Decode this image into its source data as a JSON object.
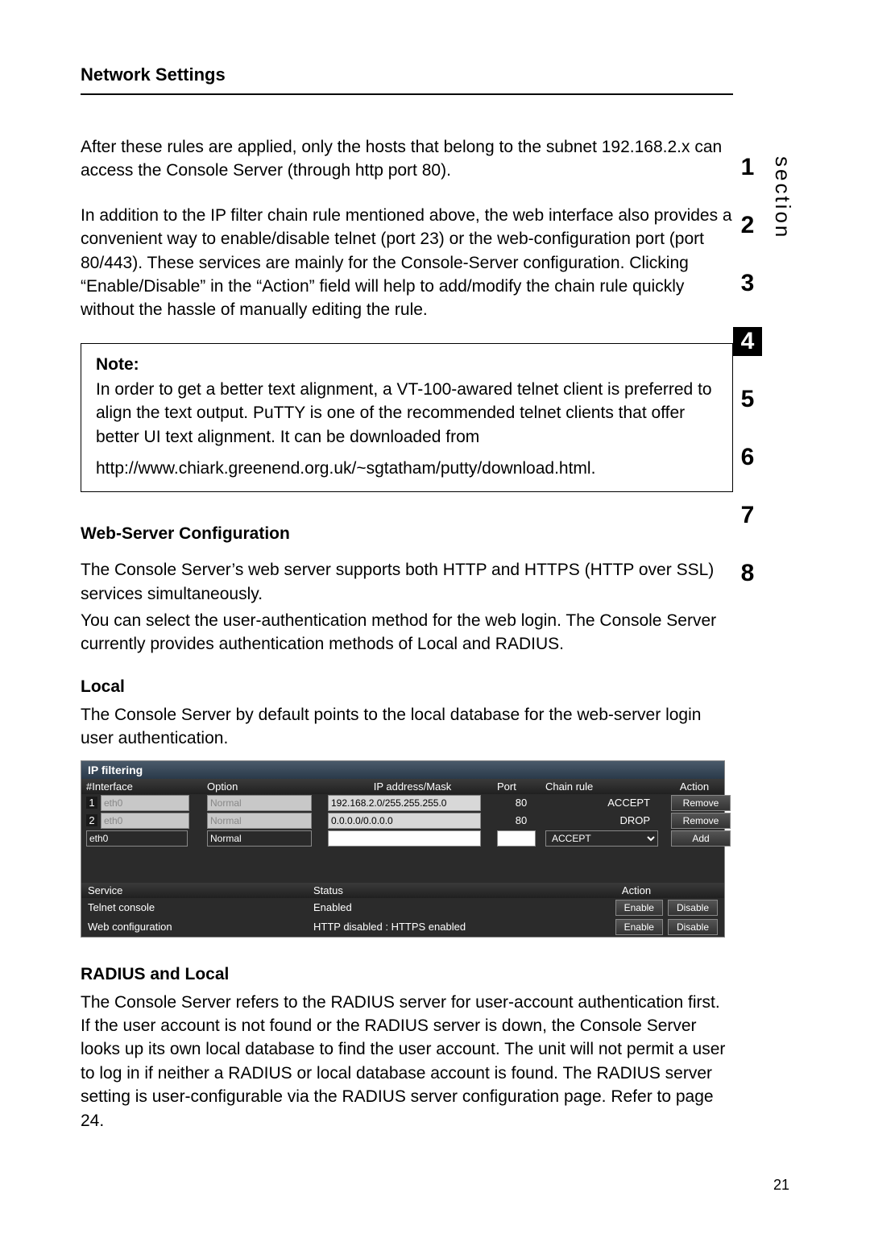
{
  "page_title": "Network Settings",
  "page_number": "21",
  "sidebar": {
    "label": "section",
    "items": [
      "1",
      "2",
      "3",
      "4",
      "5",
      "6",
      "7",
      "8"
    ],
    "active_index": 3
  },
  "paragraphs": {
    "p1": "After these rules are applied, only the hosts that belong to the subnet 192.168.2.x can access the Console Server (through http port 80).",
    "p2": "In addition to the IP filter chain rule mentioned above, the web interface also provides a convenient way to enable/disable telnet (port 23) or the web-configuration port (port 80/443). These services are mainly for the Console-Server configuration. Clicking “Enable/Disable” in the “Action” field will help to add/modify the chain rule quickly without the hassle of manually editing the rule.",
    "web_p1": "The Console Server’s web server supports both HTTP and HTTPS (HTTP over SSL) services simultaneously.",
    "web_p2": "You can select the user-authentication method for the web login. The Console Server currently provides authentication methods of Local and RADIUS.",
    "local_p": "The Console Server by default points to the local database for the web-server login user authentication.",
    "radius_p": "The Console Server refers to the RADIUS server for user-account authentication first. If the user account is not found or the RADIUS server is down, the Console Server looks up its own local database to find the user account. The unit will not permit a user to log in if neither a RADIUS or local database account is found. The RADIUS server setting is user-configurable via the RADIUS server configuration page. Refer to page 24."
  },
  "note": {
    "title": "Note:",
    "body": "In order to get a better text alignment, a VT-100-awared telnet client is preferred to align the text output. PuTTY is one of the recommended telnet clients that offer better UI text alignment. It can be downloaded from",
    "url": "http://www.chiark.greenend.org.uk/~sgtatham/putty/download.html."
  },
  "headings": {
    "webserver": "Web-Server Configuration",
    "local": "Local",
    "radius": "RADIUS and Local"
  },
  "ipfilter": {
    "title": "IP filtering",
    "headers": {
      "iface": "#Interface",
      "option": "Option",
      "ipmask": "IP address/Mask",
      "port": "Port",
      "chain": "Chain rule",
      "action": "Action"
    },
    "rows": [
      {
        "num": "1",
        "iface": "eth0",
        "option": "Normal",
        "ip": "192.168.2.0/255.255.255.0",
        "port": "80",
        "chain": "ACCEPT",
        "btn": "Remove"
      },
      {
        "num": "2",
        "iface": "eth0",
        "option": "Normal",
        "ip": "0.0.0.0/0.0.0.0",
        "port": "80",
        "chain": "DROP",
        "btn": "Remove"
      }
    ],
    "newrow": {
      "iface": "eth0",
      "option": "Normal",
      "ip": "",
      "port": "",
      "chain": "ACCEPT",
      "btn": "Add"
    },
    "services": {
      "headers": {
        "service": "Service",
        "status": "Status",
        "action": "Action"
      },
      "rows": [
        {
          "name": "Telnet console",
          "status": "Enabled",
          "enable": "Enable",
          "disable": "Disable"
        },
        {
          "name": "Web configuration",
          "status": "HTTP disabled : HTTPS enabled",
          "enable": "Enable",
          "disable": "Disable"
        }
      ]
    }
  }
}
